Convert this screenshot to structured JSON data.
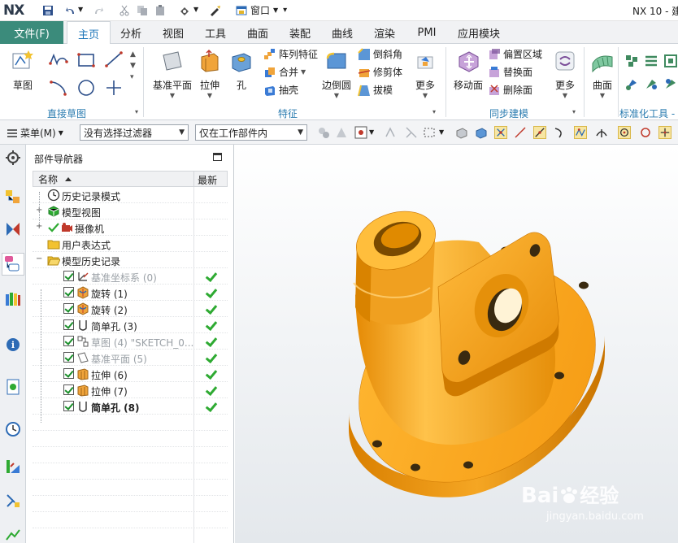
{
  "titlebar": {
    "logo": "NX",
    "window_menu": "窗口",
    "app_title": "NX 10 - 建"
  },
  "tabs": {
    "file": "文件(F)",
    "items": [
      "主页",
      "分析",
      "视图",
      "工具",
      "曲面",
      "装配",
      "曲线",
      "渲染",
      "PMI",
      "应用模块"
    ],
    "active": "主页"
  },
  "ribbon": {
    "sketch_label": "草图",
    "group_direct_sketch": "直接草图",
    "datum_plane": "基准平面",
    "extrude": "拉伸",
    "hole": "孔",
    "pattern_feature": "阵列特征",
    "unite": "合并",
    "shell": "抽壳",
    "edge_blend": "边倒圆",
    "chamfer": "倒斜角",
    "trim_body": "修剪体",
    "draft": "拔模",
    "more1": "更多",
    "group_feature": "特征",
    "move_face": "移动面",
    "offset_region": "偏置区域",
    "replace_face": "替换面",
    "delete_face": "删除面",
    "more2": "更多",
    "group_sync": "同步建模",
    "surface": "曲面",
    "group_std_tools": "标准化工具 - G"
  },
  "selection_bar": {
    "menu_label": "菜单(M)",
    "filter_value": "没有选择过滤器",
    "scope_value": "仅在工作部件内"
  },
  "navigator": {
    "title": "部件导航器",
    "col_name": "名称",
    "col_latest": "最新",
    "rows": [
      {
        "label": "历史记录模式",
        "style": "normal"
      },
      {
        "label": "模型视图",
        "style": "normal"
      },
      {
        "label": "摄像机",
        "style": "normal"
      },
      {
        "label": "用户表达式",
        "style": "normal"
      },
      {
        "label": "模型历史记录",
        "style": "normal"
      },
      {
        "label": "基准坐标系 (0)",
        "style": "dim"
      },
      {
        "label": "旋转 (1)",
        "style": "normal"
      },
      {
        "label": "旋转 (2)",
        "style": "normal"
      },
      {
        "label": "简单孔 (3)",
        "style": "normal"
      },
      {
        "label": "草图 (4) \"SKETCH_0...",
        "style": "dim"
      },
      {
        "label": "基准平面 (5)",
        "style": "dim"
      },
      {
        "label": "拉伸 (6)",
        "style": "normal"
      },
      {
        "label": "拉伸 (7)",
        "style": "normal"
      },
      {
        "label": "简单孔 (8)",
        "style": "bold"
      }
    ]
  },
  "watermark": {
    "brand": "Bai",
    "brand_suffix": "经验",
    "url": "jingyan.baidu.com"
  },
  "colors": {
    "file_tab": "#3b8b7b",
    "active_tab_text": "#1a74b8",
    "group_label": "#2b7cb0",
    "part_orange": "#f5a623",
    "check_green": "#2eaa32"
  }
}
